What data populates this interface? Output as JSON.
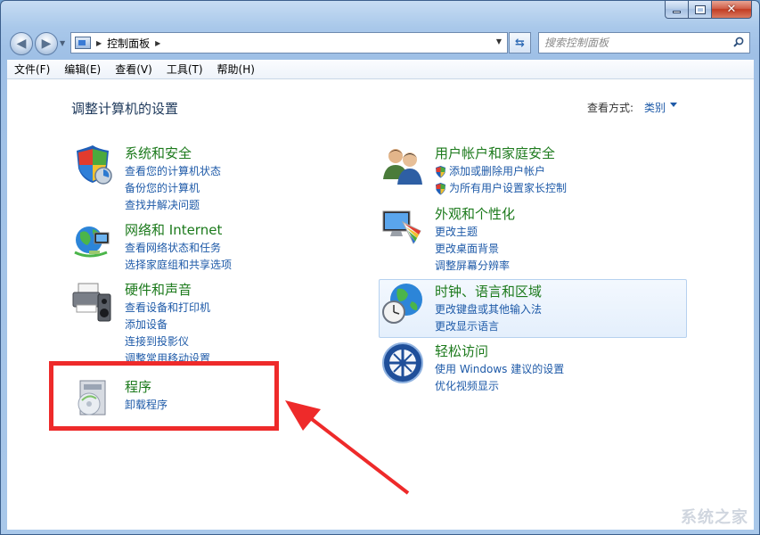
{
  "window": {
    "caption_close": "✕",
    "caption_max": "",
    "caption_min": ""
  },
  "nav": {
    "address": "控制面板",
    "search_placeholder": "搜索控制面板"
  },
  "menu": [
    "文件(F)",
    "编辑(E)",
    "查看(V)",
    "工具(T)",
    "帮助(H)"
  ],
  "content": {
    "heading": "调整计算机的设置",
    "view_label": "查看方式:",
    "view_value": "类别"
  },
  "categories": {
    "security": {
      "title": "系统和安全",
      "links": [
        "查看您的计算机状态",
        "备份您的计算机",
        "查找并解决问题"
      ]
    },
    "network": {
      "title": "网络和 Internet",
      "links": [
        "查看网络状态和任务",
        "选择家庭组和共享选项"
      ]
    },
    "hardware": {
      "title": "硬件和声音",
      "links": [
        "查看设备和打印机",
        "添加设备",
        "连接到投影仪",
        "调整常用移动设置"
      ]
    },
    "programs": {
      "title": "程序",
      "links": [
        "卸载程序"
      ]
    },
    "users": {
      "title": "用户帐户和家庭安全",
      "links": [
        "添加或删除用户帐户",
        "为所有用户设置家长控制"
      ]
    },
    "appearance": {
      "title": "外观和个性化",
      "links": [
        "更改主题",
        "更改桌面背景",
        "调整屏幕分辨率"
      ]
    },
    "clock": {
      "title": "时钟、语言和区域",
      "links": [
        "更改键盘或其他输入法",
        "更改显示语言"
      ]
    },
    "ease": {
      "title": "轻松访问",
      "links": [
        "使用 Windows 建议的设置",
        "优化视频显示"
      ]
    }
  },
  "watermark": "系统之家",
  "colors": {
    "category_title": "#1c7a1c",
    "link": "#1e5aa8",
    "annotation": "#ee2a2a"
  }
}
